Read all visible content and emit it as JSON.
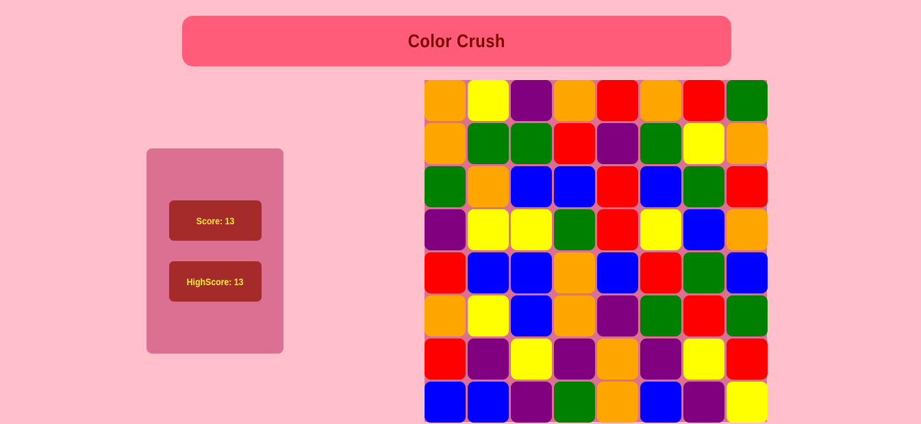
{
  "title": "Color Crush",
  "score_label": "Score: 13",
  "highscore_label": "HighScore: 13",
  "colors": {
    "orange": "#ffa500",
    "yellow": "#ffff00",
    "purple": "#800080",
    "red": "#ff0000",
    "green": "#008000",
    "blue": "#0000ff"
  },
  "board": [
    [
      "orange",
      "yellow",
      "purple",
      "orange",
      "red",
      "orange",
      "red",
      "green"
    ],
    [
      "orange",
      "green",
      "green",
      "red",
      "purple",
      "green",
      "yellow",
      "orange"
    ],
    [
      "green",
      "orange",
      "blue",
      "blue",
      "red",
      "blue",
      "green",
      "red"
    ],
    [
      "purple",
      "yellow",
      "yellow",
      "green",
      "red",
      "yellow",
      "blue",
      "orange"
    ],
    [
      "red",
      "blue",
      "blue",
      "orange",
      "blue",
      "red",
      "green",
      "blue"
    ],
    [
      "orange",
      "yellow",
      "blue",
      "orange",
      "purple",
      "green",
      "red",
      "green"
    ],
    [
      "red",
      "purple",
      "yellow",
      "purple",
      "orange",
      "purple",
      "yellow",
      "red"
    ],
    [
      "blue",
      "blue",
      "purple",
      "green",
      "orange",
      "blue",
      "purple",
      "yellow"
    ]
  ]
}
